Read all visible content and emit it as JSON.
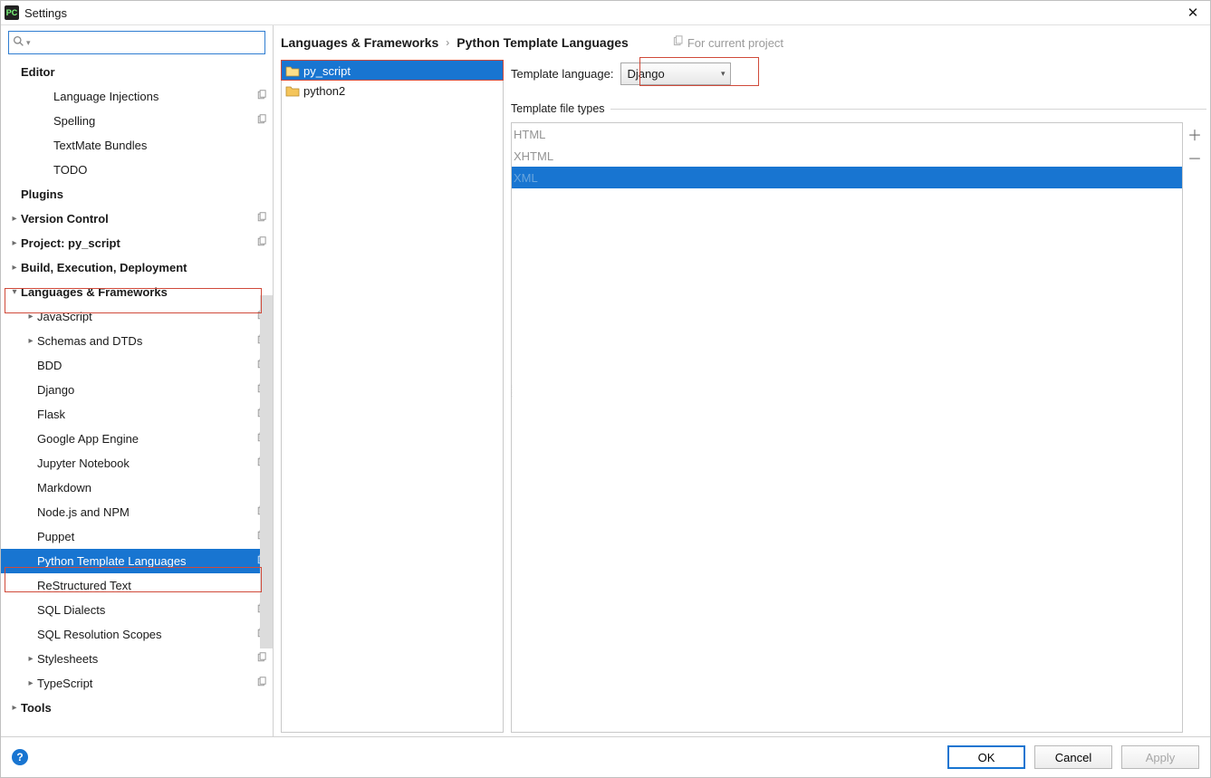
{
  "window": {
    "title": "Settings",
    "app_icon_text": "PC"
  },
  "search": {
    "value": ""
  },
  "sidebar": {
    "items": [
      {
        "label": "Editor",
        "level": 0,
        "arrow": "none",
        "bold": true,
        "copy": false
      },
      {
        "label": "Language Injections",
        "level": 2,
        "arrow": "none",
        "bold": false,
        "copy": true
      },
      {
        "label": "Spelling",
        "level": 2,
        "arrow": "none",
        "bold": false,
        "copy": true
      },
      {
        "label": "TextMate Bundles",
        "level": 2,
        "arrow": "none",
        "bold": false,
        "copy": false
      },
      {
        "label": "TODO",
        "level": 2,
        "arrow": "none",
        "bold": false,
        "copy": false
      },
      {
        "label": "Plugins",
        "level": 0,
        "arrow": "none",
        "bold": true,
        "copy": false
      },
      {
        "label": "Version Control",
        "level": 0,
        "arrow": "right",
        "bold": true,
        "copy": true
      },
      {
        "label": "Project: py_script",
        "level": 0,
        "arrow": "right",
        "bold": true,
        "copy": true
      },
      {
        "label": "Build, Execution, Deployment",
        "level": 0,
        "arrow": "right",
        "bold": true,
        "copy": false
      },
      {
        "label": "Languages & Frameworks",
        "level": 0,
        "arrow": "down",
        "bold": true,
        "copy": false
      },
      {
        "label": "JavaScript",
        "level": 1,
        "arrow": "right",
        "bold": false,
        "copy": true
      },
      {
        "label": "Schemas and DTDs",
        "level": 1,
        "arrow": "right",
        "bold": false,
        "copy": true
      },
      {
        "label": "BDD",
        "level": 1,
        "arrow": "none",
        "bold": false,
        "copy": true
      },
      {
        "label": "Django",
        "level": 1,
        "arrow": "none",
        "bold": false,
        "copy": true
      },
      {
        "label": "Flask",
        "level": 1,
        "arrow": "none",
        "bold": false,
        "copy": true
      },
      {
        "label": "Google App Engine",
        "level": 1,
        "arrow": "none",
        "bold": false,
        "copy": true
      },
      {
        "label": "Jupyter Notebook",
        "level": 1,
        "arrow": "none",
        "bold": false,
        "copy": true
      },
      {
        "label": "Markdown",
        "level": 1,
        "arrow": "none",
        "bold": false,
        "copy": false
      },
      {
        "label": "Node.js and NPM",
        "level": 1,
        "arrow": "none",
        "bold": false,
        "copy": true
      },
      {
        "label": "Puppet",
        "level": 1,
        "arrow": "none",
        "bold": false,
        "copy": true
      },
      {
        "label": "Python Template Languages",
        "level": 1,
        "arrow": "none",
        "bold": false,
        "copy": true,
        "selected": true
      },
      {
        "label": "ReStructured Text",
        "level": 1,
        "arrow": "none",
        "bold": false,
        "copy": false
      },
      {
        "label": "SQL Dialects",
        "level": 1,
        "arrow": "none",
        "bold": false,
        "copy": true
      },
      {
        "label": "SQL Resolution Scopes",
        "level": 1,
        "arrow": "none",
        "bold": false,
        "copy": true
      },
      {
        "label": "Stylesheets",
        "level": 1,
        "arrow": "right",
        "bold": false,
        "copy": true
      },
      {
        "label": "TypeScript",
        "level": 1,
        "arrow": "right",
        "bold": false,
        "copy": true
      },
      {
        "label": "Tools",
        "level": 0,
        "arrow": "right",
        "bold": true,
        "copy": false
      }
    ],
    "highlight_lf_index": 9,
    "highlight_ptl_index": 20
  },
  "breadcrumb": {
    "root": "Languages & Frameworks",
    "leaf": "Python Template Languages",
    "scope": "For current project"
  },
  "projects": {
    "items": [
      {
        "label": "py_script",
        "selected": true
      },
      {
        "label": "python2",
        "selected": false
      }
    ]
  },
  "template_language": {
    "label": "Template language:",
    "value": "Django"
  },
  "file_types": {
    "group_label": "Template file types",
    "items": [
      {
        "label": "HTML",
        "selected": false
      },
      {
        "label": "XHTML",
        "selected": false
      },
      {
        "label": "XML",
        "selected": true
      }
    ]
  },
  "footer": {
    "ok": "OK",
    "cancel": "Cancel",
    "apply": "Apply"
  }
}
